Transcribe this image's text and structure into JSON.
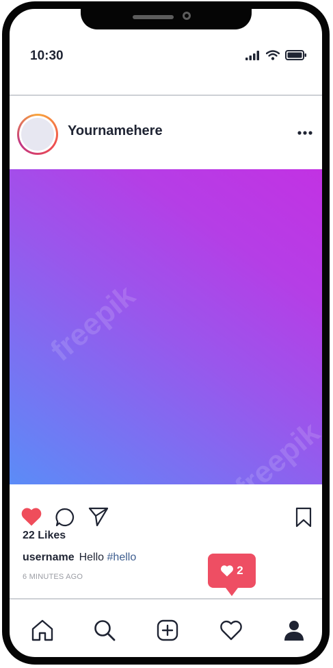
{
  "status_bar": {
    "time": "10:30",
    "icons": [
      "signal-icon",
      "wifi-icon",
      "battery-icon"
    ]
  },
  "post": {
    "author": "Yournamehere",
    "image_watermark": "freepik",
    "image_gradient": [
      "#c232e3",
      "#5b8cf7"
    ],
    "likes": "22 Likes",
    "caption_user": "username",
    "caption_text": "Hello",
    "caption_tag": "#hello",
    "time_ago": "6 MINUTES AGO"
  },
  "actions": {
    "icons": [
      "heart-icon",
      "comment-icon",
      "share-icon",
      "bookmark-icon"
    ],
    "liked": true
  },
  "notification": {
    "count": "2",
    "icon": "heart-icon",
    "color": "#ee4e63"
  },
  "tabbar": {
    "items": [
      "home-icon",
      "search-icon",
      "add-post-icon",
      "activity-icon",
      "profile-icon"
    ]
  },
  "colors": {
    "like": "#ef4d5b",
    "text": "#1f2433",
    "hashtag": "#3d5d8f"
  }
}
